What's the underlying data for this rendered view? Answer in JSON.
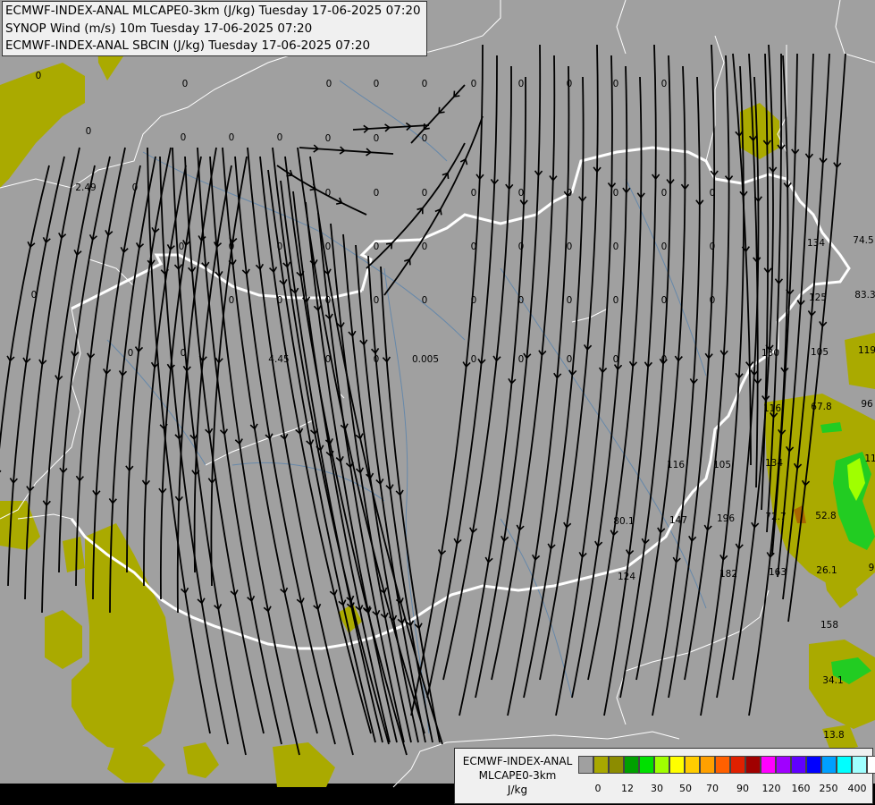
{
  "header": {
    "lines": [
      "ECMWF-INDEX-ANAL MLCAPE0-3km (J/kg) Tuesday 17-06-2025 07:20",
      "SYNOP Wind (m/s) 10m Tuesday 17-06-2025 07:20",
      "ECMWF-INDEX-ANAL SBCIN (J/kg) Tuesday 17-06-2025 07:20"
    ]
  },
  "legend": {
    "name_lines": [
      "ECMWF-INDEX-ANAL",
      "MLCAPE0-3km",
      "J/kg"
    ],
    "ticks": [
      "0",
      "12",
      "30",
      "50",
      "70",
      "90",
      "120",
      "160",
      "250",
      "400"
    ],
    "colors": [
      "#a0a0a0",
      "#a8a800",
      "#8c8c00",
      "#00a000",
      "#00e000",
      "#a0ff00",
      "#ffff00",
      "#ffcc00",
      "#ffa000",
      "#ff6000",
      "#e02000",
      "#a00000",
      "#ff00ff",
      "#a000ff",
      "#6000ff",
      "#0000ff",
      "#00a0ff",
      "#00ffff",
      "#a0ffff",
      "#ffffff"
    ]
  },
  "map_colors": {
    "background": "#a0a0a0",
    "cape_low": "#aaaa00",
    "cape_green": "#22cc22",
    "streamline": "#000000",
    "border": "#ffffff",
    "river": "#6688aa"
  },
  "values": [
    "0",
    "0",
    "0",
    "0",
    "0",
    "0",
    "0",
    "0",
    "0",
    "0",
    "0",
    "0",
    "0",
    "0",
    "0",
    "0",
    "0",
    "0",
    "0",
    "0",
    "0",
    "0",
    "0",
    "0",
    "0",
    "0",
    "0",
    "0",
    "0",
    "0",
    "0",
    "0",
    "0",
    "0",
    "0",
    "0",
    "0",
    "0",
    "0",
    "0",
    "0",
    "0",
    "0",
    "0",
    "0",
    "0",
    "0",
    "0",
    "0",
    "0",
    "0",
    "0",
    "0",
    "0",
    "0",
    "0",
    "0",
    "0",
    "0",
    "0",
    "2.49",
    "4.45",
    "0.005",
    "80.1",
    "124",
    "116",
    "105",
    "196",
    "147",
    "182",
    "163",
    "134",
    "72.7",
    "52.8",
    "26.1",
    "158",
    "34.1",
    "13.8",
    "130",
    "116",
    "67.8",
    "105",
    "125",
    "134",
    "74.5",
    "83.3",
    "119",
    "96",
    "11",
    "9"
  ]
}
